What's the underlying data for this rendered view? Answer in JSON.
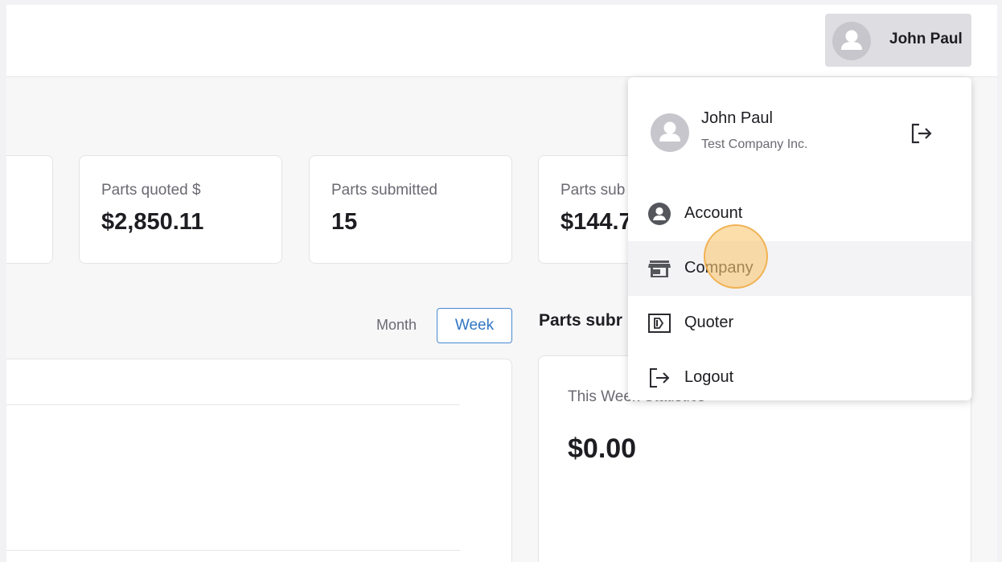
{
  "header": {
    "user_menu": {
      "name": "John Paul"
    }
  },
  "stats": [
    {
      "label": "Parts quoted $",
      "value": "$2,850.11"
    },
    {
      "label": "Parts submitted",
      "value": "15"
    },
    {
      "label": "Parts sub",
      "value": "$144.7"
    }
  ],
  "period_toggle": {
    "month_label": "Month",
    "week_label": "Week",
    "selected": "Week"
  },
  "parts_submitted_section": {
    "title": "Parts subr",
    "stat_label": "This Week Statistics",
    "stat_value": "$0.00"
  },
  "dropdown": {
    "user_name": "John Paul",
    "company_name": "Test Company Inc.",
    "items": [
      {
        "label": "Account",
        "icon": "account-circle-icon"
      },
      {
        "label": "Company",
        "icon": "store-icon"
      },
      {
        "label": "Quoter",
        "icon": "quoter-icon"
      },
      {
        "label": "Logout",
        "icon": "logout-icon"
      }
    ],
    "hovered_item": "Company"
  },
  "colors": {
    "accent": "#2f76c4",
    "click_indicator": "#f5b75a"
  }
}
